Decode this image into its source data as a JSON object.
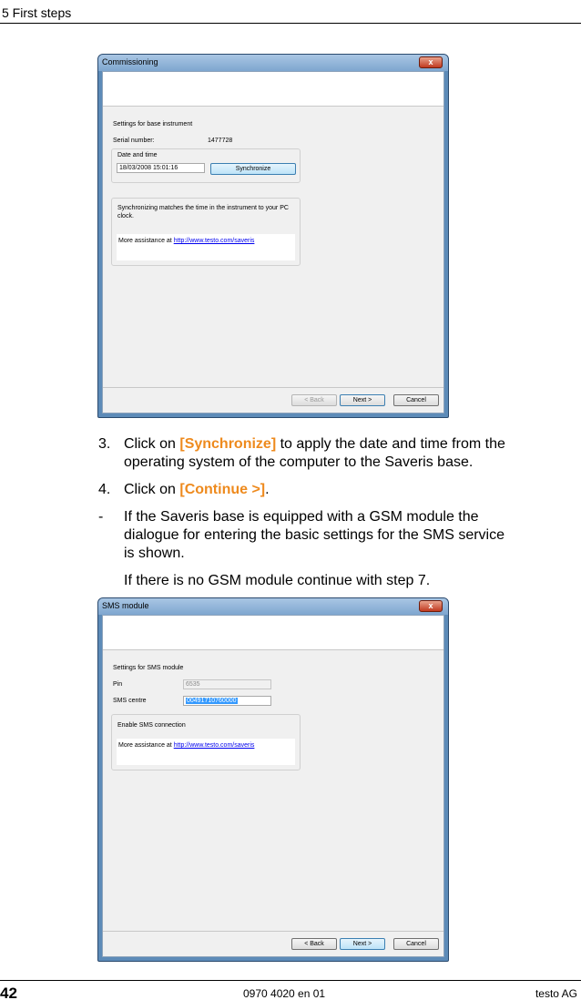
{
  "header": {
    "section": "5 First steps"
  },
  "dialog1": {
    "title": "Commissioning",
    "close": "x",
    "heading": "Settings for base instrument",
    "serial_label": "Serial number:",
    "serial_value": "1477728",
    "date_group_label": "Date and time",
    "date_value": "18/03/2008 15:01:16",
    "sync_button": "Synchronize",
    "info_text_line1": "Synchronizing matches the time in the instrument to your PC",
    "info_text_line2": "clock.",
    "assist_text": "More assistance at",
    "assist_link": "http://www.testo.com/saveris",
    "back_button": "< Back",
    "next_button": "Next >",
    "cancel_button": "Cancel"
  },
  "steps": {
    "s3_num": "3.",
    "s3_pre": "Click on ",
    "s3_hl": "[Synchronize]",
    "s3_line1_rest": " to apply the date and time from the",
    "s3_line2": "operating system of the computer to the Saveris base.",
    "s4_num": "4.",
    "s4_pre": "Click on ",
    "s4_hl": "[Continue >]",
    "s4_post": ".",
    "dash": "-",
    "gsm_line1": "If the Saveris base is equipped with a GSM module the",
    "gsm_line2": "dialogue for entering the basic settings for the SMS service",
    "gsm_line3": "is shown.",
    "no_gsm": "If there is no GSM module continue with step 7."
  },
  "dialog2": {
    "title": "SMS module",
    "close": "x",
    "heading": "Settings for SMS module",
    "pin_label": "Pin",
    "pin_value": "6535",
    "sms_centre_label": "SMS centre",
    "sms_centre_value": "00491710760000",
    "enable_label": "Enable SMS connection",
    "assist_text": "More assistance at",
    "assist_link": "http://www.testo.com/saveris",
    "back_button": "< Back",
    "next_button": "Next >",
    "cancel_button": "Cancel"
  },
  "footer": {
    "page_number": "42",
    "doc_code": "0970 4020 en 01",
    "company": "testo AG"
  }
}
